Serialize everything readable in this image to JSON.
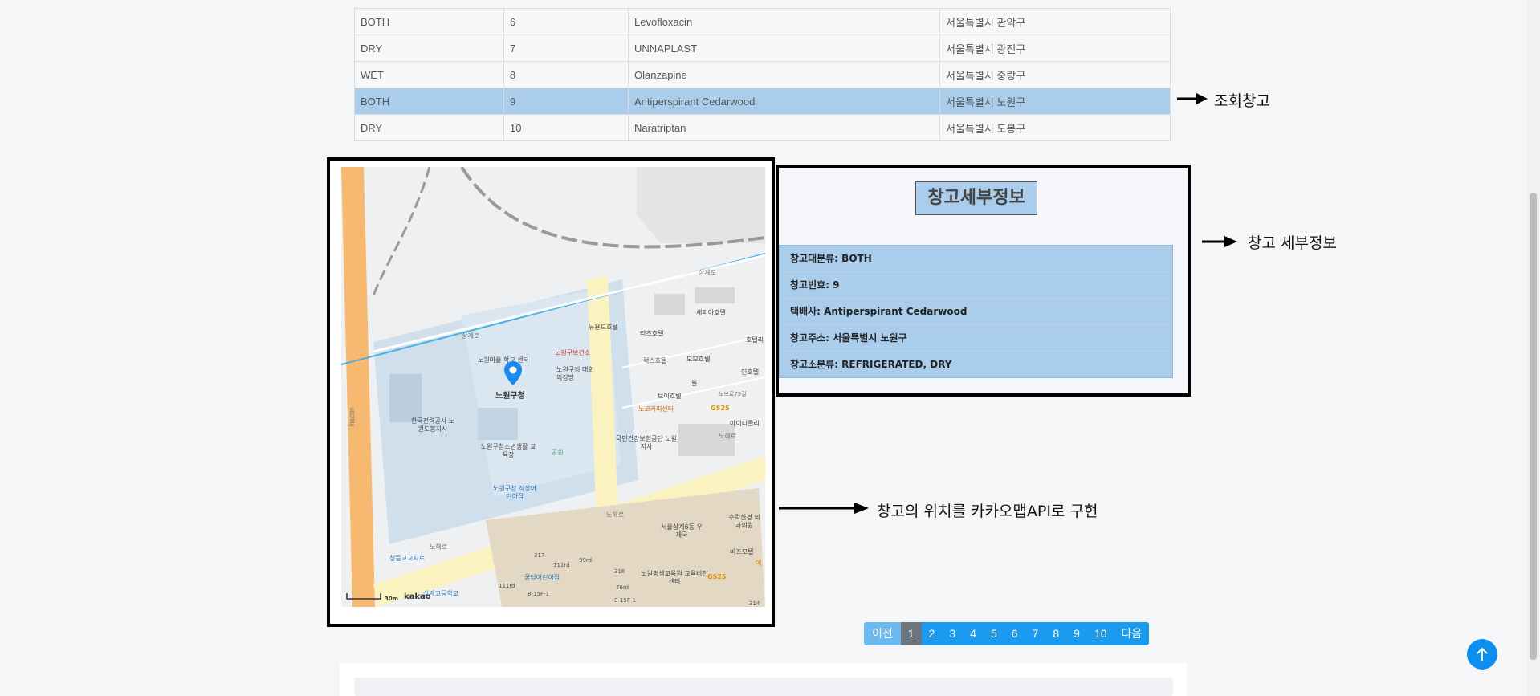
{
  "table": {
    "rows": [
      {
        "type": "BOTH",
        "no": "6",
        "company": "Levofloxacin",
        "address": "서울특별시 관악구"
      },
      {
        "type": "DRY",
        "no": "7",
        "company": "UNNAPLAST",
        "address": "서울특별시 광진구"
      },
      {
        "type": "WET",
        "no": "8",
        "company": "Olanzapine",
        "address": "서울특별시 중랑구"
      },
      {
        "type": "BOTH",
        "no": "9",
        "company": "Antiperspirant Cedarwood",
        "address": "서울특별시 노원구",
        "selected": true
      },
      {
        "type": "DRY",
        "no": "10",
        "company": "Naratriptan",
        "address": "서울특별시 도봉구"
      }
    ],
    "selected_color": "#a9cdea"
  },
  "annotations": {
    "lookup": "조회창고",
    "detail": "창고 세부정보",
    "map": "창고의 위치를 카카오맵API로 구현"
  },
  "map": {
    "marker": "노원구청",
    "logo": "kakao",
    "scale": "30m",
    "labels": [
      "상계로",
      "상계로",
      "노해로",
      "노해로",
      "노해로",
      "동일로",
      "노원마을 학교 센터",
      "노원구보건소",
      "노원구청 대회의강당",
      "뉴욘드호텔",
      "리츠호텔",
      "세피아호텔",
      "호텔리",
      "럭스호텔",
      "모모호텔",
      "딘호텔",
      "윌",
      "브이호텔",
      "노브로75길",
      "노코커피센터",
      "GS25",
      "아이디클리",
      "한국전력공사 노원도봉지사",
      "노원구청소년생활 교육장",
      "공원",
      "국민건강보험공단 노원지사",
      "노원구청 직장어린이집",
      "서울상계6동 우체국",
      "수락신경 외과의원",
      "비즈모텔",
      "예",
      "청등교교차로",
      "상계고등학교",
      "꿈담어린이집",
      "노원평생교육원 교육비전센터",
      "GS25",
      "317",
      "316",
      "111rd",
      "99rd",
      "111rd",
      "76rd",
      "8-15F-1",
      "8-15F-1",
      "314"
    ]
  },
  "detail": {
    "title": "창고세부정보",
    "items": [
      "창고대분류: BOTH",
      "창고번호: 9",
      "택배사: Antiperspirant Cedarwood",
      "창고주소: 서울특별시 노원구",
      "창고소분류: REFRIGERATED, DRY"
    ]
  },
  "pagination": {
    "prev": "이전",
    "pages": [
      "1",
      "2",
      "3",
      "4",
      "5",
      "6",
      "7",
      "8",
      "9",
      "10"
    ],
    "active": "1",
    "next": "다음"
  },
  "colors": {
    "accent": "#1a9bf0",
    "active_page": "#6c757d"
  },
  "scroll_top_icon": "arrow-up-icon"
}
